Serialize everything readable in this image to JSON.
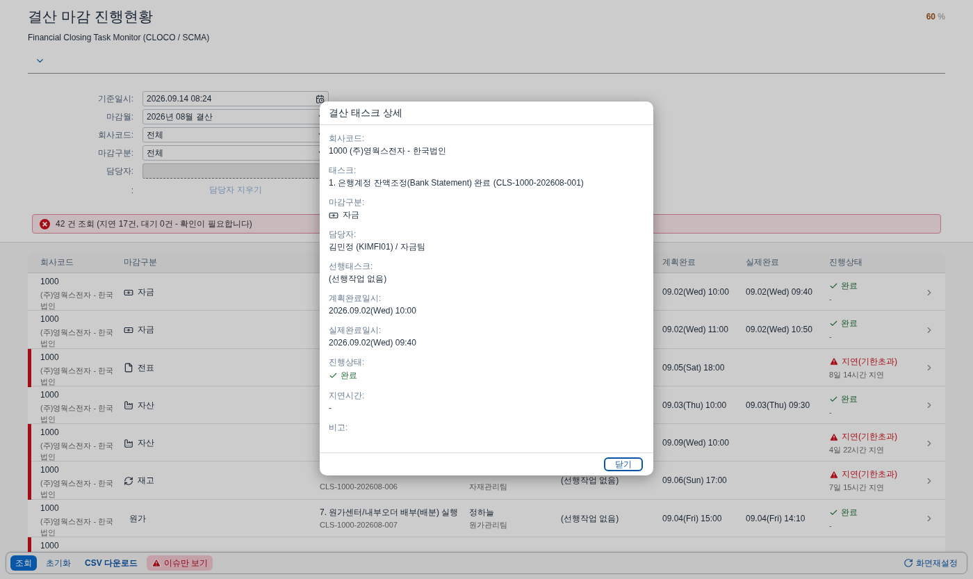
{
  "page": {
    "title": "결산 마감 진행현황",
    "subtitle": "Financial Closing Task Monitor (CLOCO / SCMA)",
    "progress_value": "60",
    "progress_unit": "%"
  },
  "filters": [
    {
      "label": "기준일시:",
      "kind": "datetime",
      "value": "2026.09.14 08:24"
    },
    {
      "label": "마감월:",
      "kind": "select",
      "value": "2026년 08월 결산"
    },
    {
      "label": "회사코드:",
      "kind": "select",
      "value": "전체"
    },
    {
      "label": "마감구분:",
      "kind": "select",
      "value": "전체"
    },
    {
      "label": "담당자:",
      "kind": "text"
    },
    {
      "label": ":",
      "kind": "link",
      "value": "담당자 지우기"
    }
  ],
  "alert": {
    "text": "42 건 조회 (지연 17건, 대기 0건 - 확인이 필요합니다)"
  },
  "table": {
    "columns": [
      {
        "kind": "company",
        "label": "회사코드"
      },
      {
        "kind": "category",
        "label": "마감구분"
      },
      {
        "kind": "planned",
        "label": "계획완료"
      },
      {
        "kind": "actual",
        "label": "실제완료"
      },
      {
        "kind": "status",
        "label": "진행상태"
      }
    ],
    "rows": [
      {
        "code": "1000",
        "company": "(주)영웍스전자 - 한국법인",
        "category": {
          "text": "자금",
          "kind": "money"
        },
        "planned": "09.02(Wed) 10:00",
        "actual": "09.02(Wed) 09:40",
        "status": {
          "text": "완료",
          "kind": "done",
          "note": "-"
        }
      },
      {
        "code": "1000",
        "company": "(주)영웍스전자 - 한국법인",
        "category": {
          "text": "자금",
          "kind": "money"
        },
        "planned": "09.02(Wed) 11:00",
        "actual": "09.02(Wed) 10:50",
        "status": {
          "text": "완료",
          "kind": "done",
          "note": "-"
        }
      },
      {
        "code": "1000",
        "company": "(주)영웍스전자 - 한국법인",
        "category": {
          "text": "전표",
          "kind": "document"
        },
        "planned": "09.05(Sat) 18:00",
        "status": {
          "text": "지연(기한초과)",
          "kind": "delayed",
          "note": "8일 14시간 지연"
        }
      },
      {
        "code": "1000",
        "company": "(주)영웍스전자 - 한국법인",
        "category": {
          "text": "자산",
          "kind": "factory"
        },
        "planned": "09.03(Thu) 10:00",
        "actual": "09.03(Thu) 09:30",
        "status": {
          "text": "완료",
          "kind": "done",
          "note": "-"
        }
      },
      {
        "code": "1000",
        "company": "(주)영웍스전자 - 한국법인",
        "category": {
          "text": "자산",
          "kind": "factory"
        },
        "planned": "09.09(Wed) 10:00",
        "status": {
          "text": "지연(기한초과)",
          "kind": "delayed",
          "note": "4일 22시간 지연"
        }
      },
      {
        "code": "1000",
        "company": "(주)영웍스전자 - 한국법인",
        "category": {
          "text": "재고",
          "kind": "cycle"
        },
        "task_id": "CLS-1000-202608-006",
        "team": "자재관리팀",
        "predecessor": "(선행작업 없음)",
        "planned": "09.06(Sun) 17:00",
        "status": {
          "text": "지연(기한초과)",
          "kind": "delayed",
          "note": "7일 15시간 지연"
        }
      },
      {
        "code": "1000",
        "company": "(주)영웍스전자 - 한국법인",
        "category": {
          "text": "원가",
          "kind": "none"
        },
        "task": "7. 원가센터/내부오더 배부(배분) 실행",
        "task_id": "CLS-1000-202608-007",
        "owner": "정하늘",
        "team": "원가관리팀",
        "predecessor": "(선행작업 없음)",
        "planned": "09.04(Fri) 15:00",
        "actual": "09.04(Fri) 14:10",
        "status": {
          "text": "완료",
          "kind": "done",
          "note": "-"
        }
      },
      {
        "code": "1000",
        "status": {
          "kind": "delayed"
        }
      }
    ]
  },
  "toolbar": {
    "buttons": [
      {
        "label": "조회",
        "kind": "primary"
      },
      {
        "label": "초기화",
        "kind": "plain"
      },
      {
        "label": "CSV 다운로드",
        "kind": "bold"
      },
      {
        "label": "이슈만 보기",
        "kind": "issue"
      }
    ],
    "reset": "화면재설정"
  },
  "dialog": {
    "title": "결산 태스크 상세",
    "fields": [
      {
        "label": "회사코드:",
        "value": "1000 (주)영웍스전자 - 한국법인",
        "kind": "text"
      },
      {
        "label": "태스크:",
        "value": "1. 은행계정 잔액조정(Bank Statement) 완료 (CLS-1000-202608-001)",
        "kind": "text"
      },
      {
        "label": "마감구분:",
        "kind": "category",
        "category": {
          "text": "자금",
          "kind": "money"
        }
      },
      {
        "label": "담당자:",
        "value": "김민정 (KIMFI01) / 자금팀",
        "kind": "text"
      },
      {
        "label": "선행태스크:",
        "value": "(선행작업 없음)",
        "kind": "text"
      },
      {
        "label": "계획완료일시:",
        "value": "2026.09.02(Wed) 10:00",
        "kind": "text"
      },
      {
        "label": "실제완료일시:",
        "value": "2026.09.02(Wed) 09:40",
        "kind": "text"
      },
      {
        "label": "진행상태:",
        "kind": "status",
        "status": {
          "text": "완료",
          "kind": "done"
        }
      },
      {
        "label": "지연시간:",
        "value": "-",
        "kind": "text"
      },
      {
        "label": "비고:",
        "kind": "text"
      }
    ],
    "close": "닫기"
  }
}
